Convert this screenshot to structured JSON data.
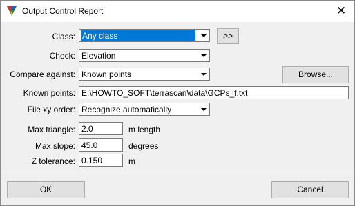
{
  "window": {
    "title": "Output Control Report",
    "close_glyph": "✕"
  },
  "fields": {
    "class_label": "Class:",
    "class_value": "Any class",
    "class_more": ">>",
    "check_label": "Check:",
    "check_value": "Elevation",
    "compare_label": "Compare against:",
    "compare_value": "Known points",
    "browse": "Browse...",
    "known_label": "Known points:",
    "known_value": "E:\\HOWTO_SOFT\\terrascan\\data\\GCPs_f.txt",
    "fileorder_label": "File xy order:",
    "fileorder_value": "Recognize automatically",
    "maxtri_label": "Max triangle:",
    "maxtri_value": "2.0",
    "maxtri_unit": "m length",
    "maxslope_label": "Max slope:",
    "maxslope_value": "45.0",
    "maxslope_unit": "degrees",
    "ztol_label": "Z tolerance:",
    "ztol_value": "0.150",
    "ztol_unit": "m"
  },
  "buttons": {
    "ok": "OK",
    "cancel": "Cancel"
  }
}
